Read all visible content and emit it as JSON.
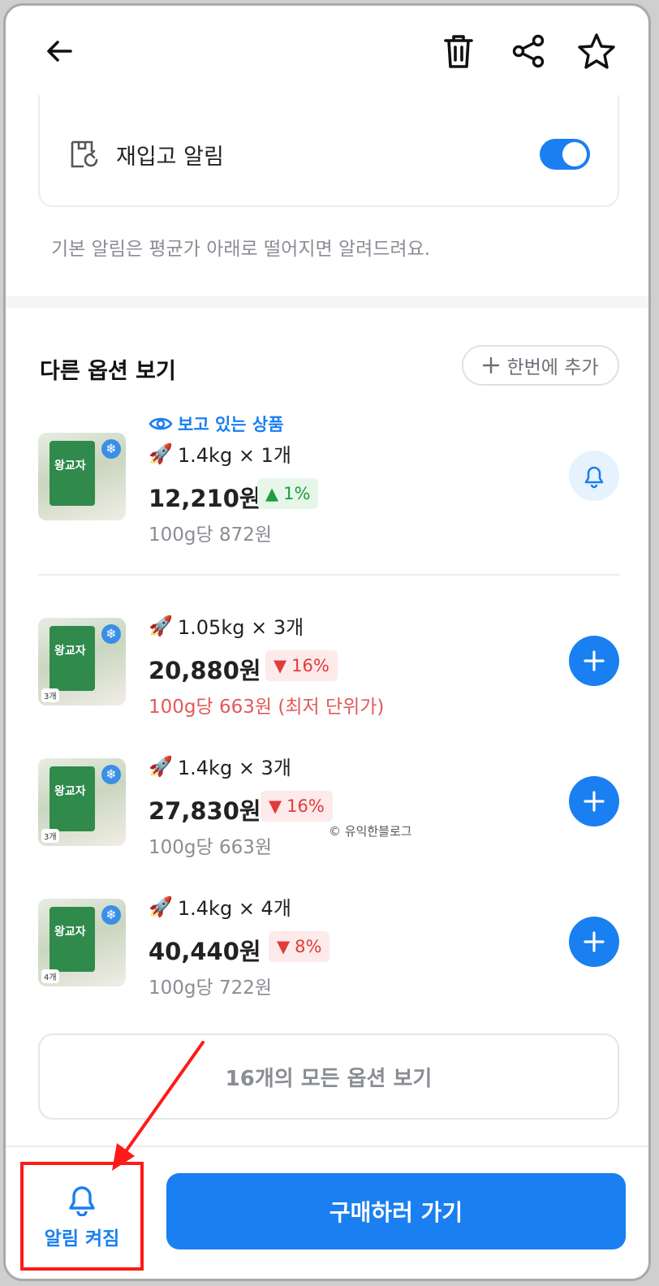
{
  "header": {
    "back_icon": "arrow-left-icon",
    "delete_icon": "trash-icon",
    "share_icon": "share-icon",
    "favorite_icon": "star-icon"
  },
  "restock": {
    "label": "재입고 알림",
    "enabled": true,
    "icon": "box-refresh-icon"
  },
  "hint": "기본 알림은 평균가 아래로 떨어지면 알려드려요.",
  "options_section": {
    "title": "다른 옵션 보기",
    "add_once_label": "한번에 추가",
    "viewing_label": "보고 있는 상품",
    "items": [
      {
        "spec": "1.4kg × 1개",
        "price": "12,210원",
        "change": "1%",
        "direction": "up",
        "unit_price": "100g당 872원",
        "pkg_text": "왕교자",
        "count_tag": "",
        "action": "bell"
      },
      {
        "spec": "1.05kg × 3개",
        "price": "20,880원",
        "change": "16%",
        "direction": "down",
        "unit_price": "100g당 663원 (최저 단위가)",
        "pkg_text": "왕교자",
        "count_tag": "3개",
        "action": "plus"
      },
      {
        "spec": "1.4kg × 3개",
        "price": "27,830원",
        "change": "16%",
        "direction": "down",
        "unit_price": "100g당 663원",
        "pkg_text": "왕교자",
        "count_tag": "3개",
        "action": "plus"
      },
      {
        "spec": "1.4kg × 4개",
        "price": "40,440원",
        "change": "8%",
        "direction": "down",
        "unit_price": "100g당 722원",
        "pkg_text": "왕교자",
        "count_tag": "4개",
        "action": "plus"
      }
    ],
    "all_options_label": "16개의 모든 옵션 보기"
  },
  "watermark": "© 유익한블로그",
  "bottom_bar": {
    "alarm_label": "알림 켜짐",
    "buy_label": "구매하러 가기"
  },
  "colors": {
    "accent": "#1a7ff1",
    "up": "#1f9c3c",
    "down": "#e23b3b",
    "highlight": "#ff1a1a"
  }
}
